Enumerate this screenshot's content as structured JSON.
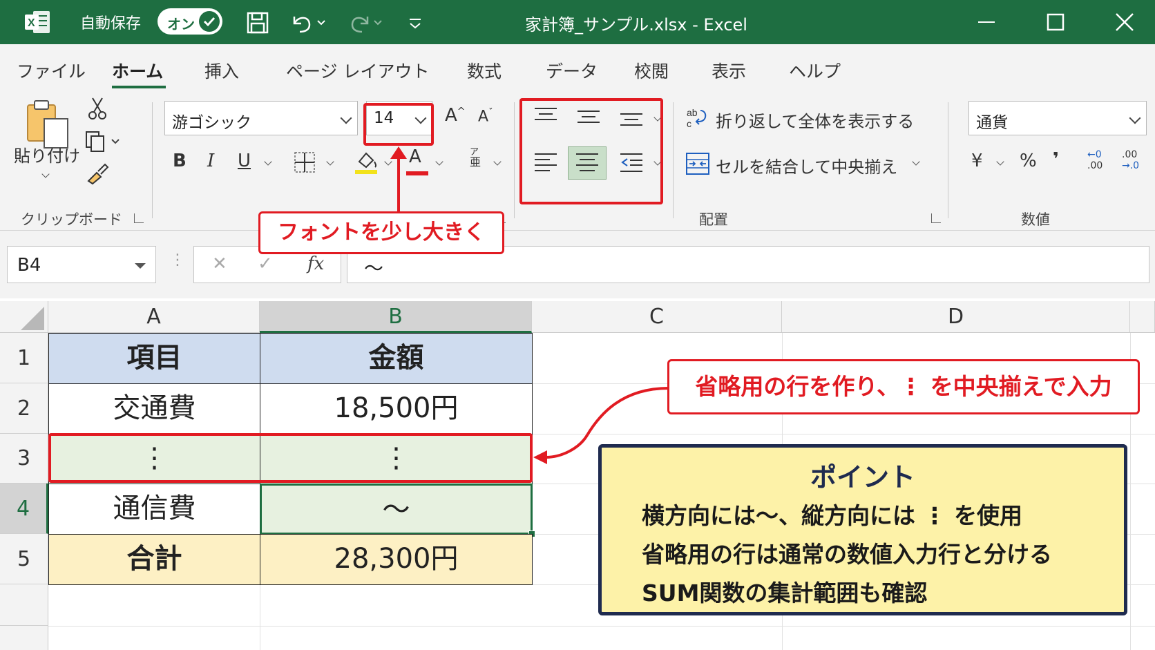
{
  "titlebar": {
    "autosave_label": "自動保存",
    "autosave_state": "オン",
    "document_title": "家計簿_サンプル.xlsx  -  Excel"
  },
  "tabs": [
    "ファイル",
    "ホーム",
    "挿入",
    "ページ レイアウト",
    "数式",
    "データ",
    "校閲",
    "表示",
    "ヘルプ"
  ],
  "active_tab": "ホーム",
  "ribbon": {
    "clipboard": {
      "paste_label": "貼り付け",
      "group_label": "クリップボード"
    },
    "font": {
      "font_name": "游ゴシック",
      "font_size": "14",
      "bold": "B",
      "italic": "I",
      "underline": "U",
      "grow": "A",
      "shrink": "A",
      "font_color_glyph": "A",
      "phonetic_top": "ア",
      "phonetic_bottom": "亜"
    },
    "alignment": {
      "wrap_text": "折り返して全体を表示する",
      "merge_center": "セルを結合して中央揃え",
      "group_label": "配置"
    },
    "number": {
      "format": "通貨",
      "currency": "¥",
      "percent": "%",
      "comma": "❜",
      "inc_decimal": ".00",
      "dec_decimal": ".00",
      "inc_top": "←0",
      "dec_top": ".00",
      "dec_bottom": "→.0",
      "group_label": "数値"
    }
  },
  "formulabar": {
    "namebox": "B4",
    "fx": "fx",
    "cancel": "✕",
    "enter": "✓",
    "content": "〜"
  },
  "grid": {
    "columns": [
      "A",
      "B",
      "C",
      "D"
    ],
    "rows": [
      "1",
      "2",
      "3",
      "4",
      "5"
    ],
    "cells": [
      [
        "項目",
        "金額"
      ],
      [
        "交通費",
        "18,500円"
      ],
      [
        "⋮",
        "⋮"
      ],
      [
        "通信費",
        "〜"
      ],
      [
        "合計",
        "28,300円"
      ]
    ]
  },
  "callouts": {
    "font_hint": "フォントを少し大きく",
    "row_hint": "省略用の行を作り、⋮ を中央揃えで入力"
  },
  "point": {
    "title": "ポイント",
    "lines": [
      "横方向には〜、縦方向には ⋮ を使用",
      "省略用の行は通常の数値入力行と分ける",
      "SUM関数の集計範囲も確認"
    ]
  },
  "colors": {
    "excel_green": "#1e6e41",
    "header_blue": "#cfdcef",
    "light_green": "#e7f1e0",
    "total_yellow": "#fdf0c4",
    "callout_red": "#e11b22",
    "point_bg": "#fdf2a8",
    "point_border": "#1f2b4f"
  }
}
